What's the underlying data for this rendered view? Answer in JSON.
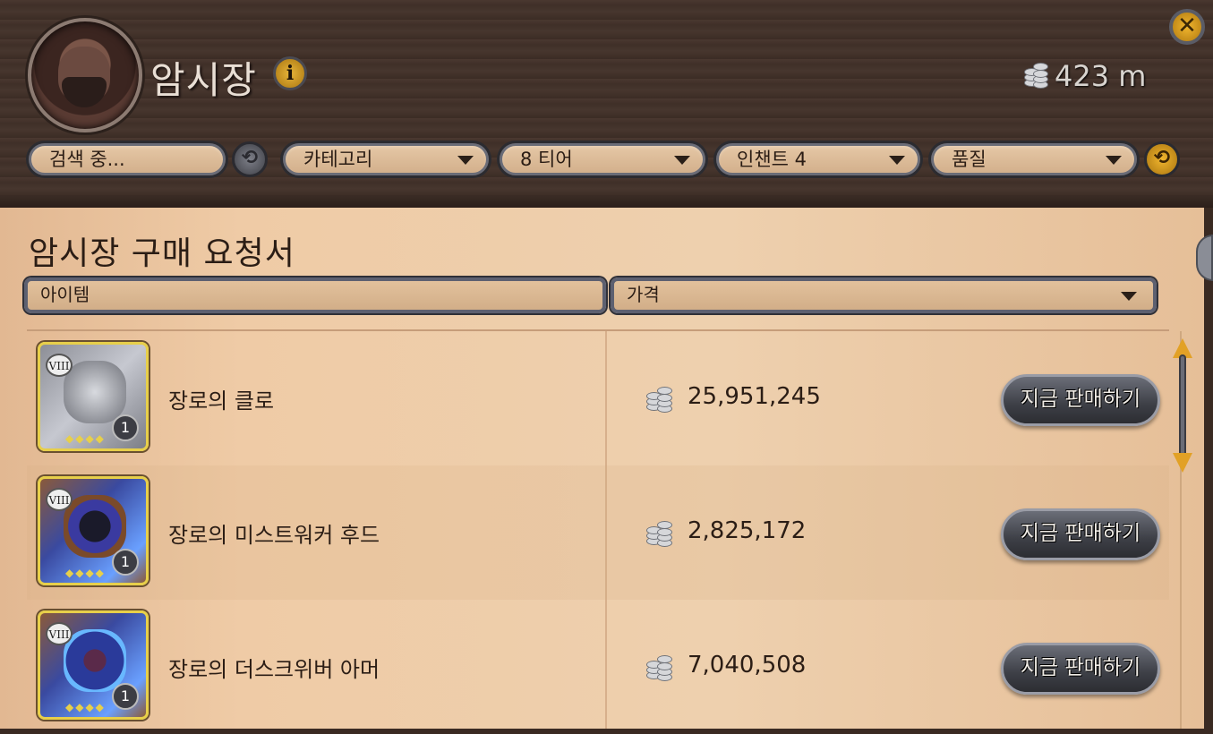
{
  "header": {
    "title": "암시장",
    "currency": {
      "value": "423 m",
      "icon": "silver-coins-icon"
    }
  },
  "filters": {
    "search_placeholder": "검색 중...",
    "category": "카테고리",
    "tier": "8 티어",
    "enchant": "인챈트 4",
    "quality": "품질"
  },
  "section": {
    "title": "암시장 구매 요청서",
    "columns": {
      "item": "아이템",
      "price": "가격"
    }
  },
  "rows": [
    {
      "tier": "VIII",
      "qty": "1",
      "name": "장로의 클로",
      "price": "25,951,245",
      "button": "지금 판매하기",
      "icon": "claw-icon"
    },
    {
      "tier": "VIII",
      "qty": "1",
      "name": "장로의 미스트워커 후드",
      "price": "2,825,172",
      "button": "지금 판매하기",
      "icon": "hood-icon"
    },
    {
      "tier": "VIII",
      "qty": "1",
      "name": "장로의 더스크위버 아머",
      "price": "7,040,508",
      "button": "지금 판매하기",
      "icon": "armor-icon"
    }
  ],
  "colors": {
    "accent": "#e2a126",
    "panel": "#efcba6",
    "text": "#2b1d15"
  }
}
